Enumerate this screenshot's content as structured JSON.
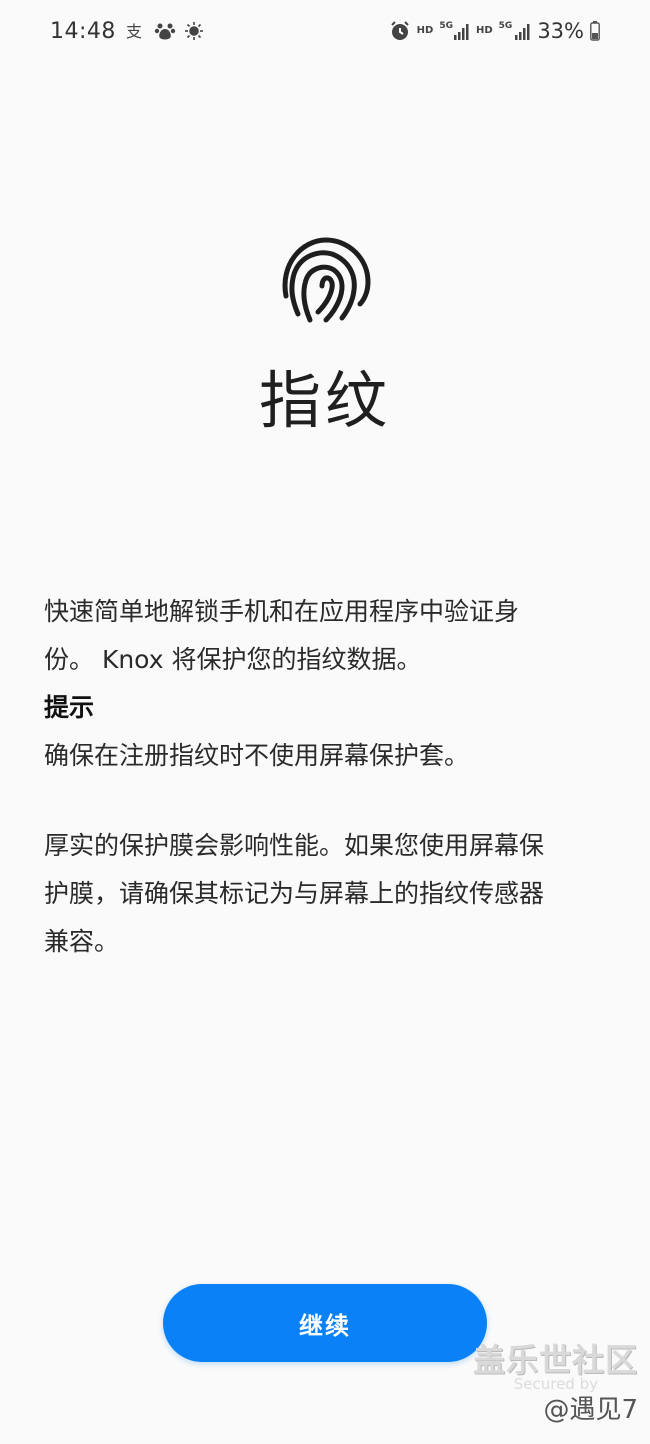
{
  "status_bar": {
    "time": "14:48",
    "left_icons": [
      "alipay-icon",
      "baidu-paw-icon",
      "sun-icon"
    ],
    "hd1": "HD",
    "g1": "5G",
    "hd2": "HD",
    "g2": "5G",
    "battery_percent": "33%"
  },
  "screen": {
    "title": "指纹",
    "description_line1": "快速简单地解锁手机和在应用程序中验证身",
    "description_line2": "份。 Knox 将保护您的指纹数据。",
    "tip_heading": "提示",
    "tip_1": "确保在注册指纹时不使用屏幕保护套。",
    "tip_2_line1": "厚实的保护膜会影响性能。如果您使用屏幕保",
    "tip_2_line2": "护膜，请确保其标记为与屏幕上的指纹传感器",
    "tip_2_line3": "兼容。",
    "continue_label": "继续"
  },
  "watermark": {
    "line1": "盖乐世社区",
    "line2": "Secured by",
    "line3": "@遇见7"
  },
  "colors": {
    "accent": "#0a81f7",
    "background": "#fafafa",
    "text": "#1a1a1a"
  }
}
